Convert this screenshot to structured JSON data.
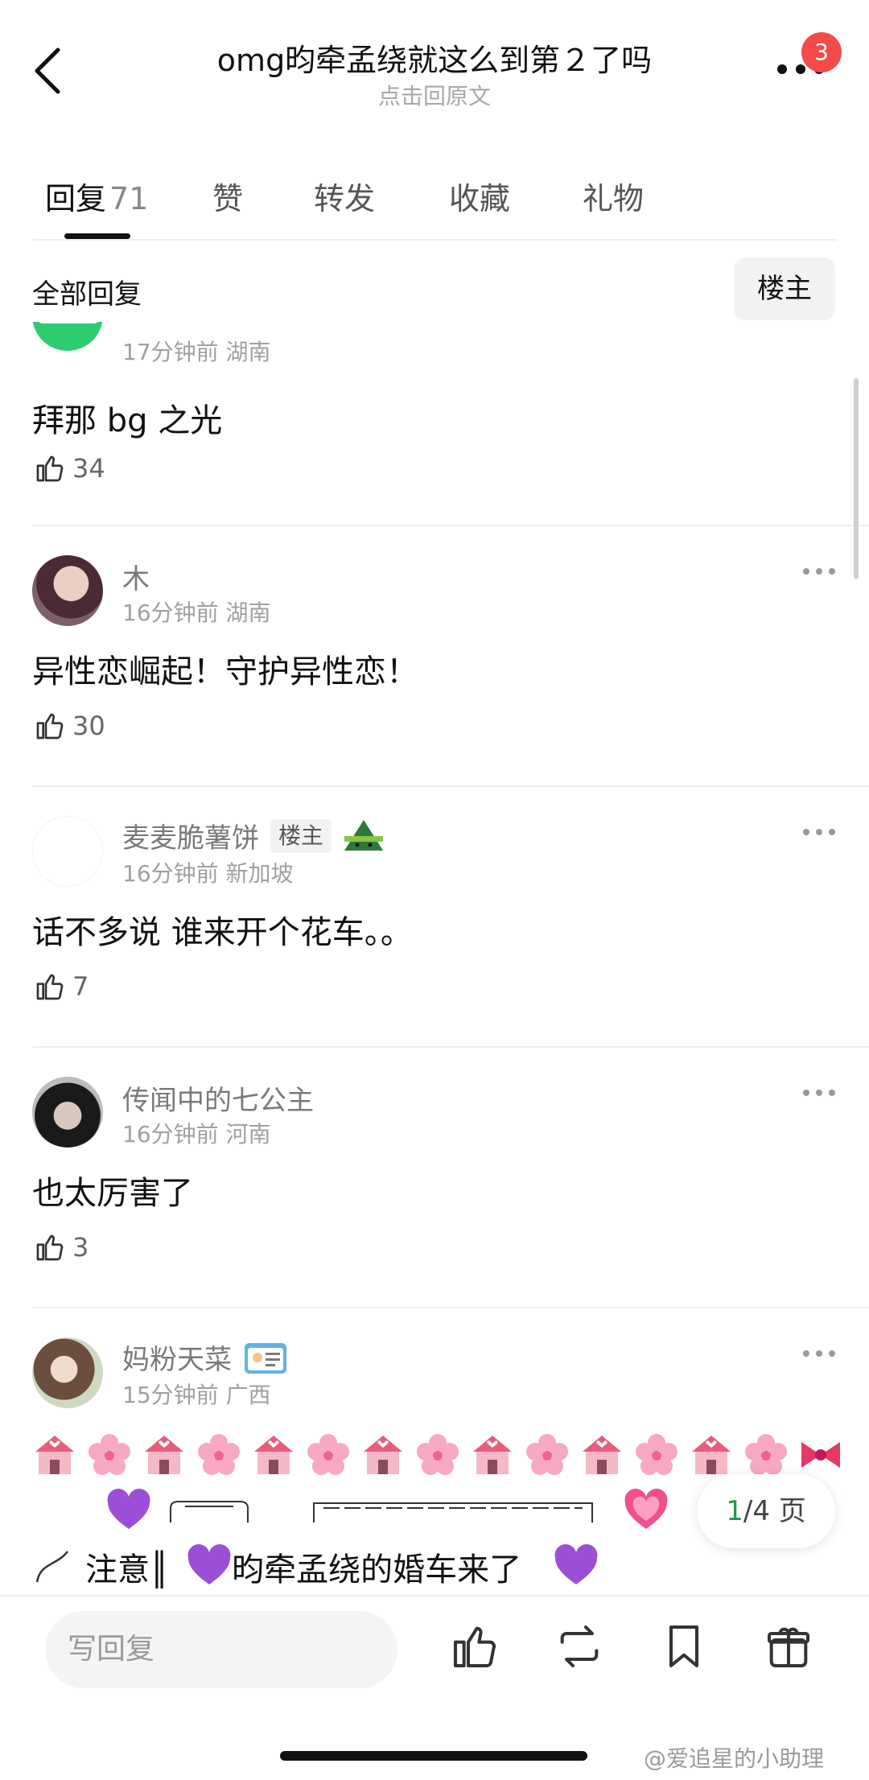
{
  "header": {
    "title": "omg昀牵孟绕就这么到第２了吗",
    "subtitle": "点击回原文",
    "badge_count": "3"
  },
  "tabs": [
    {
      "label": "回复",
      "count": "71",
      "active": true
    },
    {
      "label": "赞"
    },
    {
      "label": "转发"
    },
    {
      "label": "收藏"
    },
    {
      "label": "礼物"
    }
  ],
  "filter": {
    "all_replies_label": "全部回复",
    "owner_label": "楼主"
  },
  "comments": [
    {
      "meta": "17分钟前 湖南",
      "text": "拜那 bg 之光",
      "likes": "34"
    },
    {
      "username": "木",
      "meta": "16分钟前 湖南",
      "text": "异性恋崛起！守护异性恋！",
      "likes": "30"
    },
    {
      "username": "麦麦脆薯饼",
      "owner_tag": "楼主",
      "meta": "16分钟前 新加坡",
      "text": "话不多说 谁来开个花车。。",
      "likes": "7"
    },
    {
      "username": "传闻中的七公主",
      "meta": "16分钟前 河南",
      "text": "也太厉害了",
      "likes": "3"
    },
    {
      "username": "妈粉天菜",
      "meta": "15分钟前 广西",
      "art_line_1": "注意║",
      "art_line_2": "昀牵孟绕的婚车来了"
    }
  ],
  "page_indicator": {
    "current": "1",
    "rest": "/4 页"
  },
  "bottom_bar": {
    "reply_placeholder": "写回复"
  },
  "watermark": "@爱追星的小助理",
  "icons": [
    "back-arrow-icon",
    "more-dots-icon",
    "thumbs-up-icon",
    "repost-icon",
    "bookmark-icon",
    "gift-icon",
    "wedding-chapel-emoji",
    "cherry-blossom-emoji",
    "ribbon-emoji",
    "purple-heart-emoji",
    "growing-heart-emoji",
    "id-card-emoji",
    "rice-dumpling-emoji"
  ],
  "colors": {
    "badge": "#f44a4a",
    "page_current": "#1b9c4f",
    "avatar_green": "#2ecc71"
  }
}
